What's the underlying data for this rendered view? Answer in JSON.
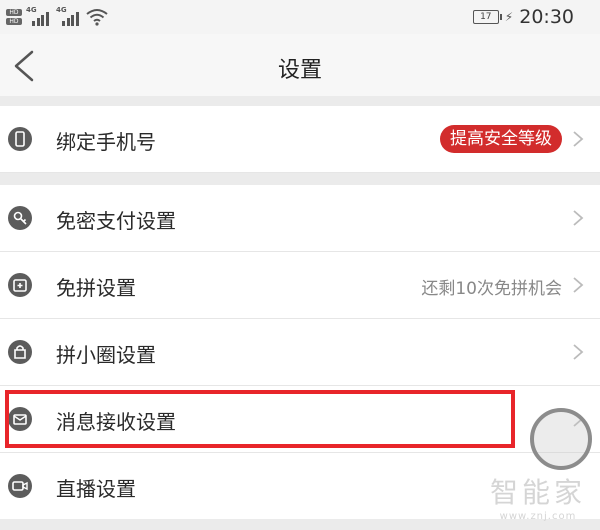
{
  "status_bar": {
    "sim1_badge": "HD",
    "sim2_badge": "HD",
    "network1": "4G",
    "network2": "4G",
    "battery": "17",
    "time": "20:30"
  },
  "nav": {
    "title": "设置"
  },
  "rows": [
    {
      "label": "绑定手机号",
      "badge": "提高安全等级"
    },
    {
      "label": "免密支付设置"
    },
    {
      "label": "免拼设置",
      "value": "还剩10次免拼机会"
    },
    {
      "label": "拼小圈设置"
    },
    {
      "label": "消息接收设置"
    },
    {
      "label": "直播设置"
    }
  ],
  "watermark": {
    "name": "智能家",
    "url": "www.znj.com"
  },
  "colors": {
    "badge_red": "#d22c2c",
    "highlight_red": "#e8252a",
    "icon_gray": "#5c5c5c",
    "gap_gray": "#ebebeb"
  }
}
